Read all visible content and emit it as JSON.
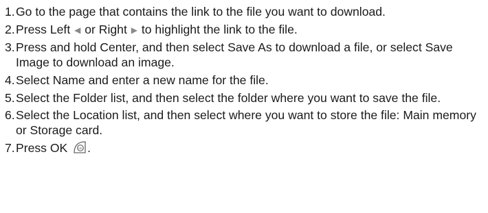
{
  "steps": [
    {
      "num": "1.",
      "text": "Go to the page that contains the link to the file you want to download."
    },
    {
      "num": "2.",
      "text_before": "Press Left",
      "icon_left": "left-arrow-icon",
      "text_middle": "or Right",
      "icon_right": "right-arrow-icon",
      "text_after": "to highlight the link to the file."
    },
    {
      "num": "3.",
      "text": "Press and hold Center, and then select Save As to download a file, or select Save Image to download an image."
    },
    {
      "num": "4.",
      "text": "Select Name and enter a new name for the file."
    },
    {
      "num": "5.",
      "text": "Select the Folder list, and then select the folder where you want to save the file."
    },
    {
      "num": "6.",
      "text": "Select the Location list, and then select where you want to store the file: Main memory or Storage card."
    },
    {
      "num": "7.",
      "text_before": "Press OK",
      "icon": "ok-key-icon",
      "text_after": "."
    }
  ]
}
